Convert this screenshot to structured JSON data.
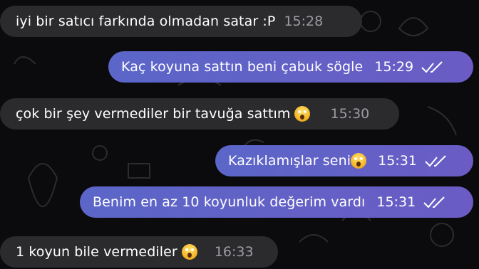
{
  "messages": [
    {
      "direction": "in",
      "text": "iyi bir satıcı farkında olmadan satar :P",
      "time": "15:28",
      "emoji": false,
      "ticks": false
    },
    {
      "direction": "out",
      "text": "Kaç koyuna sattın beni çabuk sögle",
      "time": "15:29",
      "emoji": false,
      "ticks": true
    },
    {
      "direction": "in",
      "text": "çok bir şey vermediler bir tavuğa sattım",
      "time": "15:30",
      "emoji": true,
      "emoji_name": "screaming-face-icon",
      "ticks": false
    },
    {
      "direction": "out",
      "text": "Kazıklamışlar seni",
      "time": "15:31",
      "emoji": true,
      "emoji_name": "screaming-face-icon",
      "ticks": true
    },
    {
      "direction": "out",
      "text": "Benim en az 10 koyunluk değerim vardı",
      "time": "15:31",
      "emoji": false,
      "ticks": true
    },
    {
      "direction": "in",
      "text": "1 koyun bile vermediler",
      "time": "16:33",
      "emoji": true,
      "emoji_name": "screaming-face-icon",
      "ticks": false
    }
  ],
  "colors": {
    "incoming_bubble": "#2b2b2e",
    "outgoing_bubble": "#5f63c8",
    "background": "#0b0b0d",
    "read_ticks": "#ffffff"
  }
}
